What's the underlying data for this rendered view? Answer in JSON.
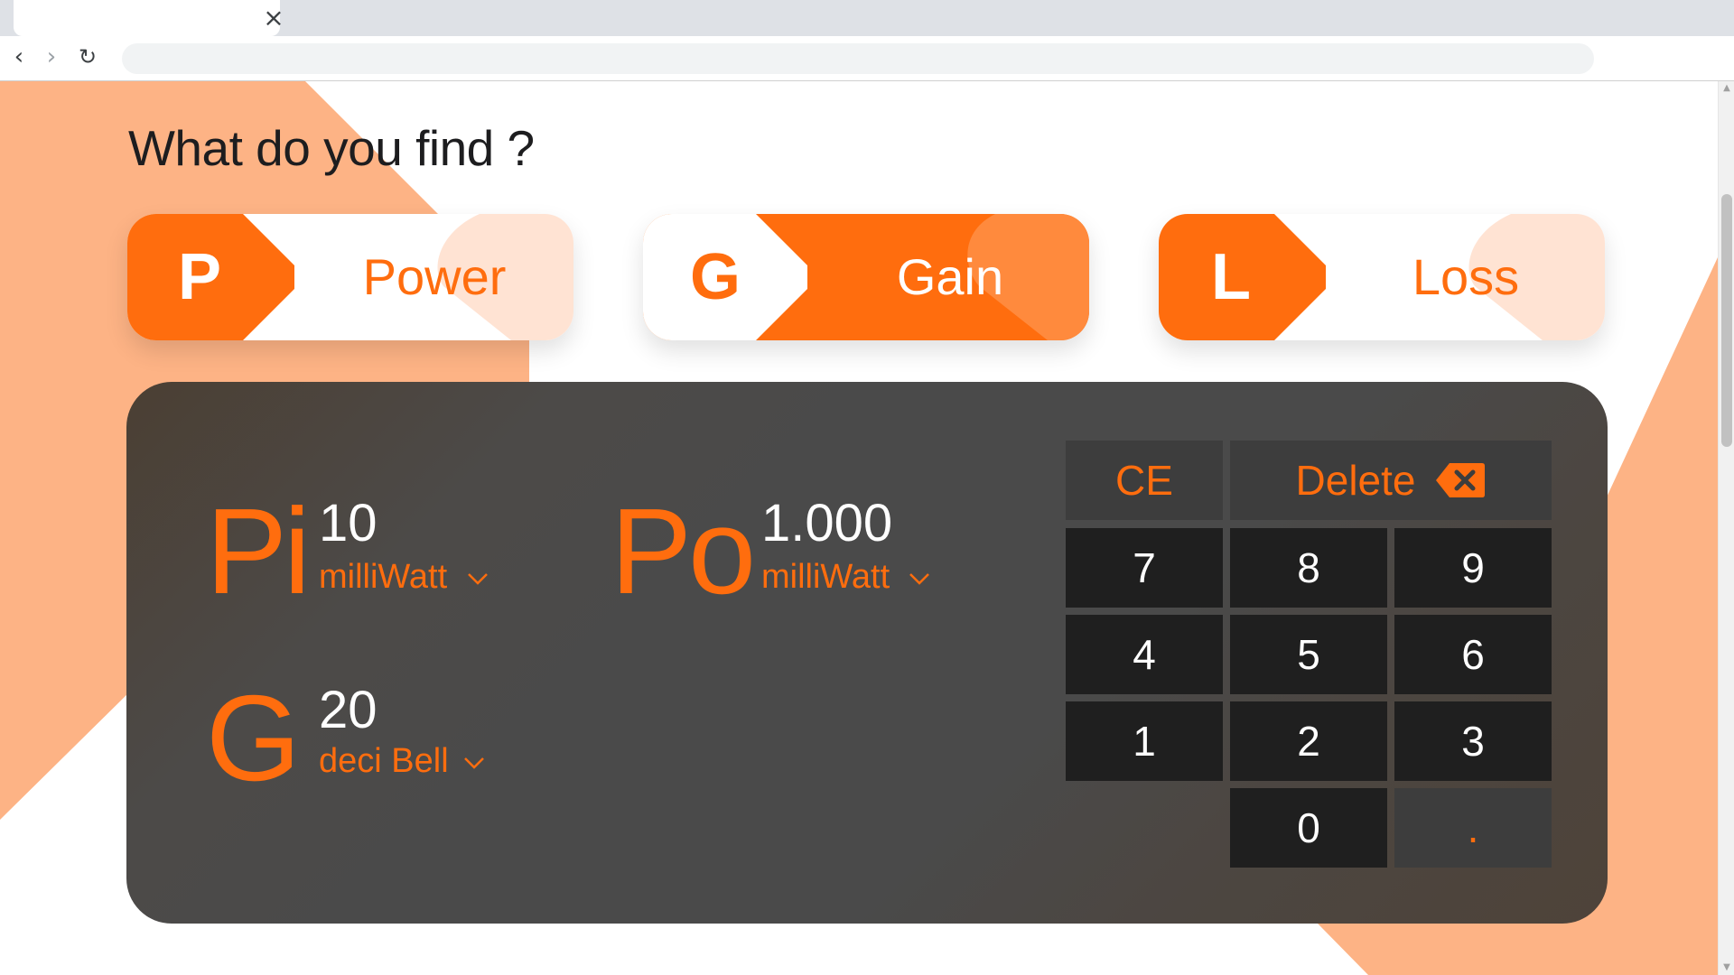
{
  "browser": {
    "tab_close": "×",
    "back_icon": "‹",
    "forward_icon": "›",
    "reload_icon": "↻"
  },
  "heading": "What do you find ?",
  "options": [
    {
      "letter": "P",
      "label": "Power",
      "selected": false
    },
    {
      "letter": "G",
      "label": "Gain",
      "selected": true
    },
    {
      "letter": "L",
      "label": "Loss",
      "selected": false
    }
  ],
  "colors": {
    "accent": "#ff6d0e",
    "accent_light": "#ffe3d3",
    "background_shape": "#fdb385",
    "panel": "#4a4a4a",
    "key": "#1f1f1f",
    "key_function": "#3d3d3d"
  },
  "calculator": {
    "variables": {
      "pi": {
        "symbol": "Pi",
        "value": "10",
        "unit": "milliWatt"
      },
      "po": {
        "symbol": "Po",
        "value": "1.000",
        "unit": "milliWatt"
      },
      "g": {
        "symbol": "G",
        "value": "20",
        "unit": "deci Bell"
      }
    },
    "keypad": {
      "ce": "CE",
      "delete": "Delete",
      "digits": [
        "7",
        "8",
        "9",
        "4",
        "5",
        "6",
        "1",
        "2",
        "3",
        "0"
      ],
      "decimal": "."
    }
  }
}
